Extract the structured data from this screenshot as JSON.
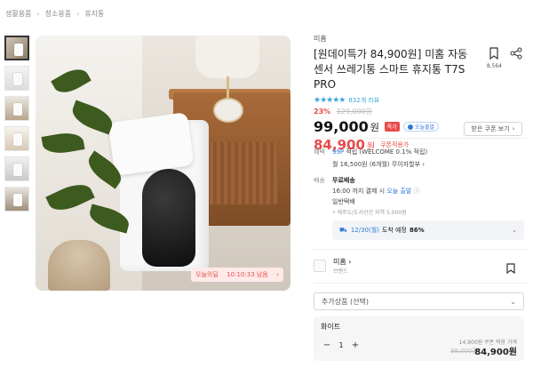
{
  "breadcrumb": [
    "생활용품",
    "청소용품",
    "휴지통"
  ],
  "hero": {
    "ribbon_label": "오늘의딜",
    "ribbon_time": "10:10:33 남음",
    "ribbon_arrow": "›"
  },
  "product": {
    "brand": "미홈",
    "title": "[원데이특가 84,900원] 미홈 자동 센서 쓰레기통 스마트 휴지통 T7S PRO",
    "rating_stars": "★★★★★",
    "review_count": "832개 리뷰",
    "discount": "23%",
    "original_price": "129,000원",
    "price": "99,000",
    "price_unit": "원",
    "today_badge": "특가",
    "delivery_badge": "오늘출발",
    "coupon_price": "84,900",
    "coupon_unit": "원",
    "coupon_label": "쿠폰적용가",
    "coupon_button": "받은 쿠폰 보기",
    "bookmark_count": "8,564"
  },
  "benefit": {
    "label": "혜택",
    "points_prefix": "99P",
    "points_text": "적립 (WELCOME 0.1% 적립)",
    "installment": "월 16,500원 (6개월) 무이자할부 ›"
  },
  "shipping": {
    "label": "배송",
    "free": "무료배송",
    "deadline_prefix": "16:00 까지 결제 시",
    "deadline_highlight": "오늘 출발",
    "method": "일반택배",
    "extra": "• 제주도/도서산간 지역 5,000원",
    "arrival_date": "12/30(월)",
    "arrival_text": "도착 예정",
    "arrival_pct": "86%"
  },
  "seller": {
    "name": "미홈 ›",
    "sub": "브랜드"
  },
  "options": {
    "select_label": "추가상품 (선택)",
    "card": {
      "name": "화이트",
      "qty": "1",
      "minus": "−",
      "plus": "+",
      "note": "14,900원 쿠폰 적용 가격",
      "orig": "99,000원",
      "price": "84,900원"
    }
  }
}
